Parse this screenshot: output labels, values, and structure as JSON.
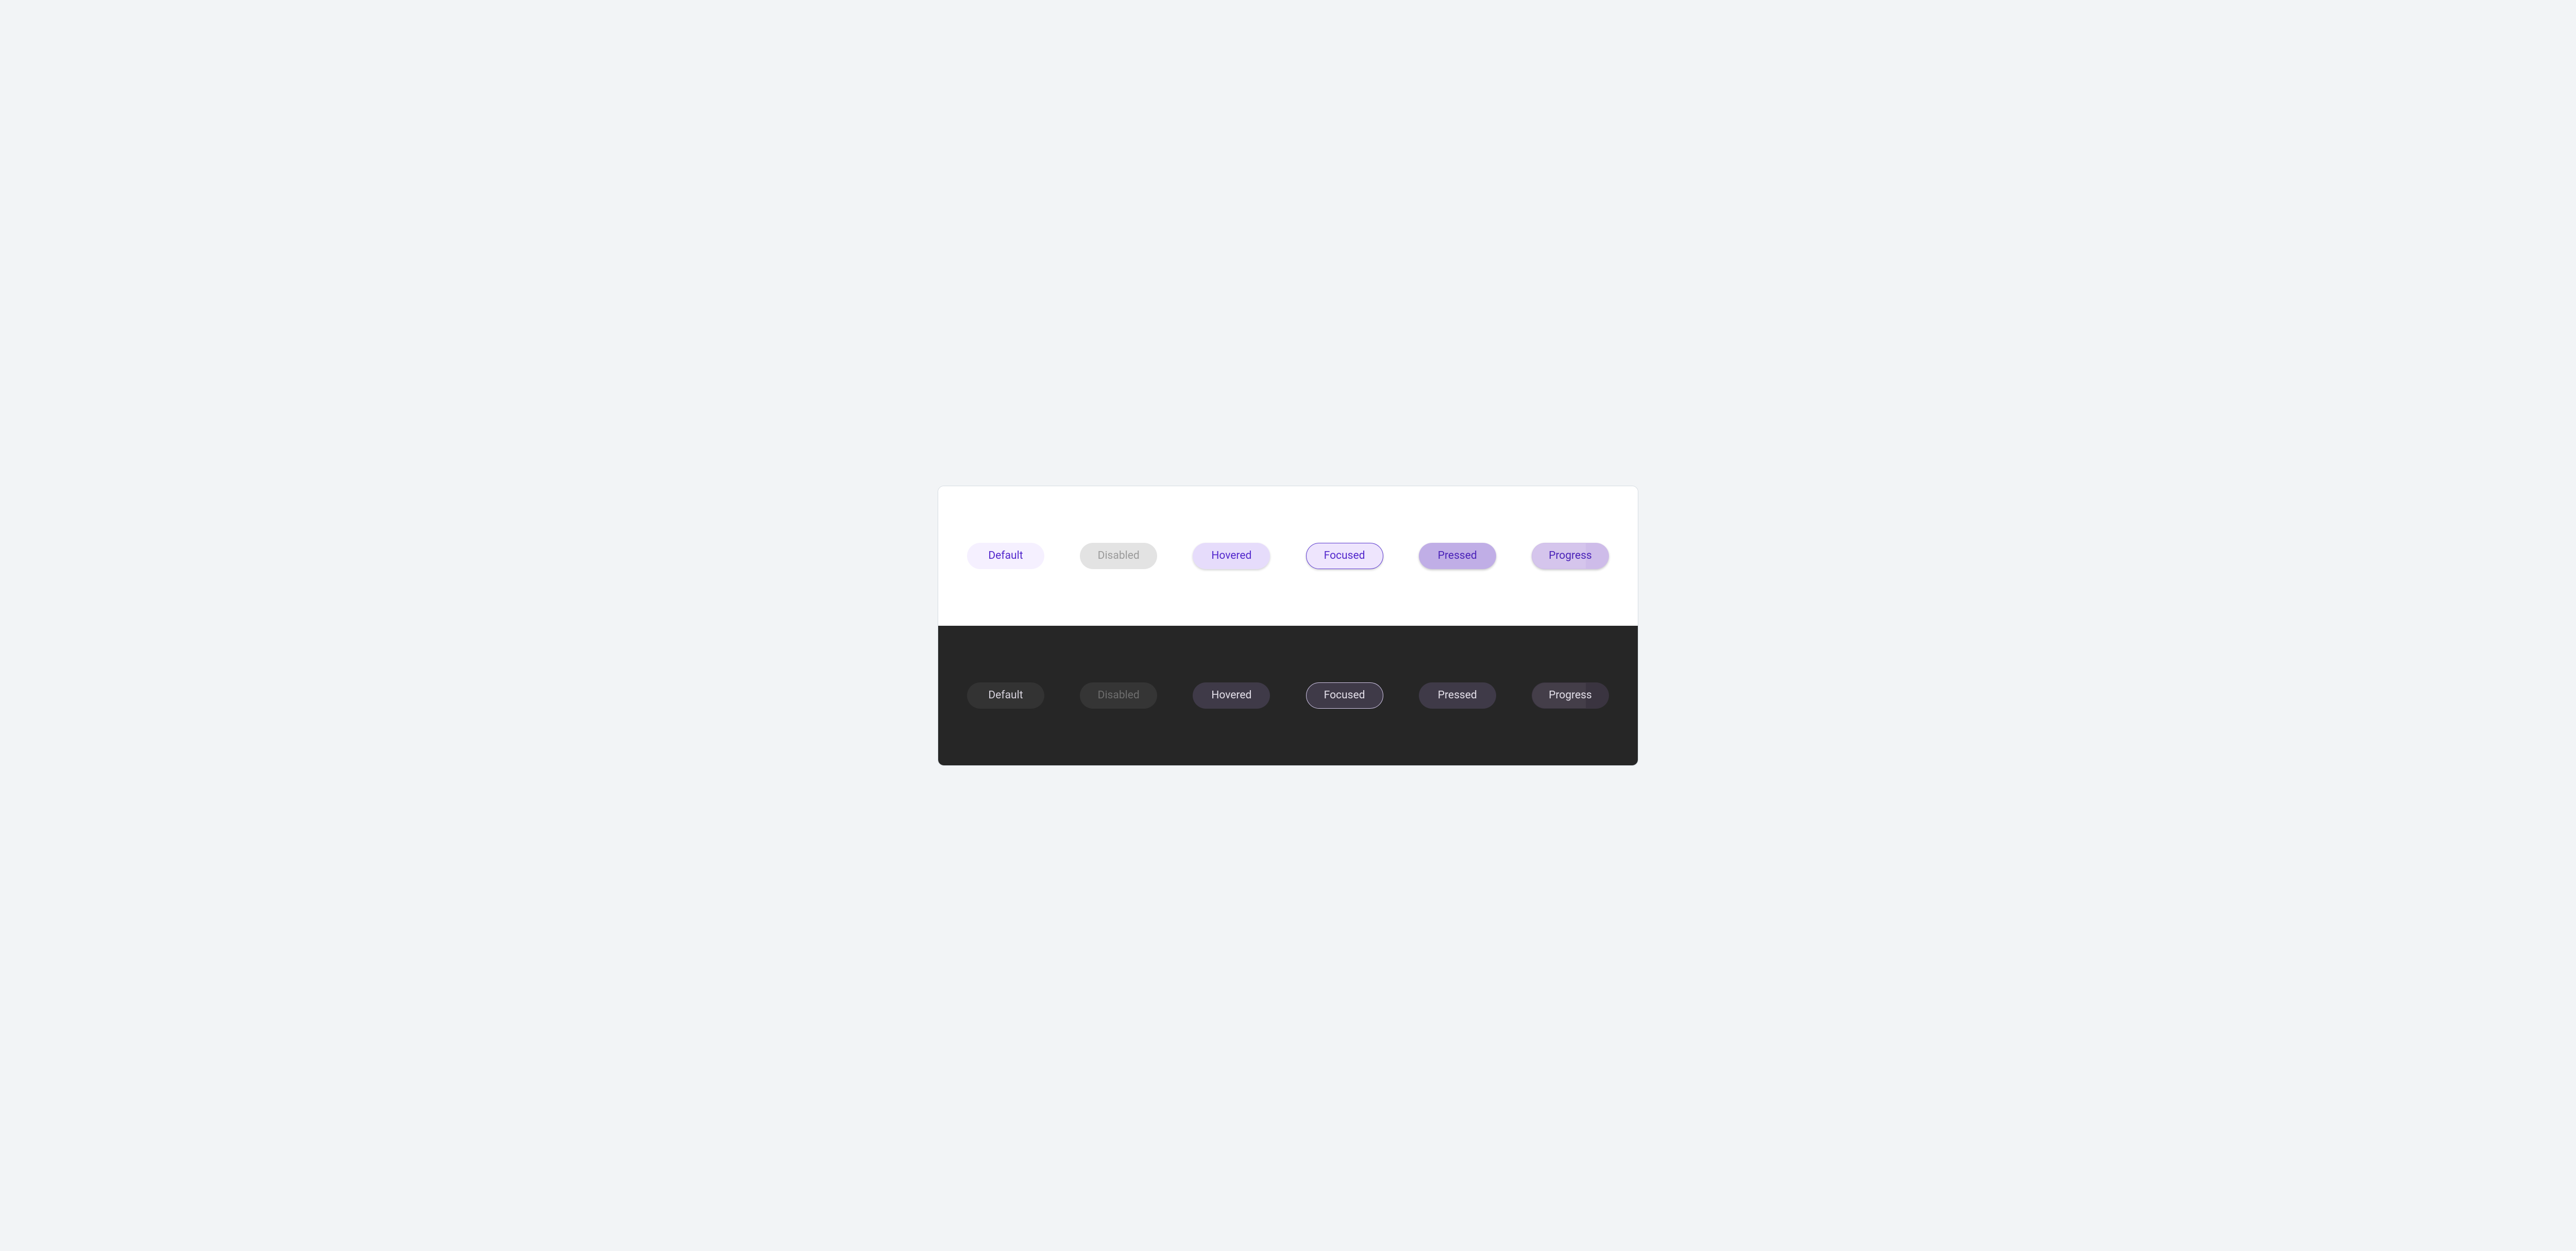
{
  "light": {
    "default": "Default",
    "disabled": "Disabled",
    "hovered": "Hovered",
    "focused": "Focused",
    "pressed": "Pressed",
    "progress": "Progress"
  },
  "dark": {
    "default": "Default",
    "disabled": "Disabled",
    "hovered": "Hovered",
    "focused": "Focused",
    "pressed": "Pressed",
    "progress": "Progress"
  },
  "colors": {
    "light_bg": "#ffffff",
    "dark_bg": "#262626",
    "accent_text_light": "#5227cc",
    "accent_text_dark": "#e4e0ea"
  },
  "progress_percent": 70
}
